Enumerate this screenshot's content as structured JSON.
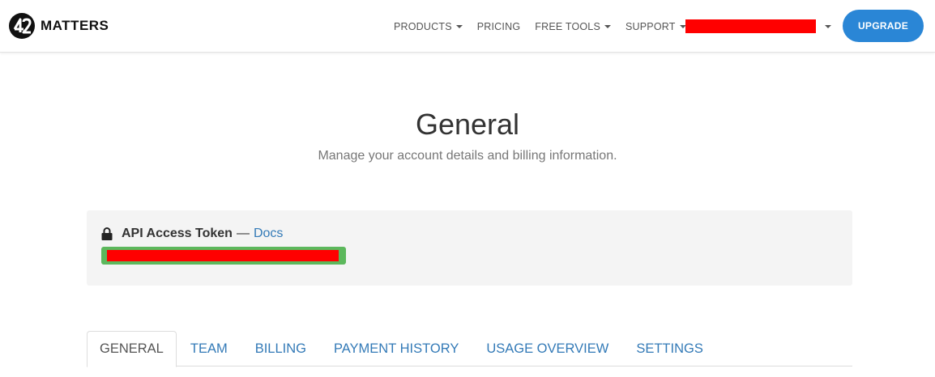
{
  "brand": {
    "name": "MATTERS",
    "logo_icon": "42matters-logo-icon"
  },
  "nav": {
    "items": [
      {
        "label": "PRODUCTS",
        "has_dropdown": true
      },
      {
        "label": "PRICING",
        "has_dropdown": false
      },
      {
        "label": "FREE TOOLS",
        "has_dropdown": true
      },
      {
        "label": "SUPPORT",
        "has_dropdown": true
      }
    ],
    "account": {
      "redacted": true,
      "has_dropdown": true
    },
    "upgrade_label": "UPGRADE"
  },
  "header": {
    "title": "General",
    "subtitle": "Manage your account details and billing information."
  },
  "token_panel": {
    "icon": "lock-icon",
    "label": "API Access Token",
    "separator": "—",
    "docs_label": "Docs",
    "token_redacted": true
  },
  "tabs": [
    {
      "label": "GENERAL",
      "active": true
    },
    {
      "label": "TEAM",
      "active": false
    },
    {
      "label": "BILLING",
      "active": false
    },
    {
      "label": "PAYMENT HISTORY",
      "active": false
    },
    {
      "label": "USAGE OVERVIEW",
      "active": false
    },
    {
      "label": "SETTINGS",
      "active": false
    }
  ],
  "colors": {
    "accent": "#2a86d6",
    "link": "#337ab7",
    "redaction": "#ff0000",
    "token_highlight": "#5cb85c",
    "panel_bg": "#f4f4f4"
  }
}
